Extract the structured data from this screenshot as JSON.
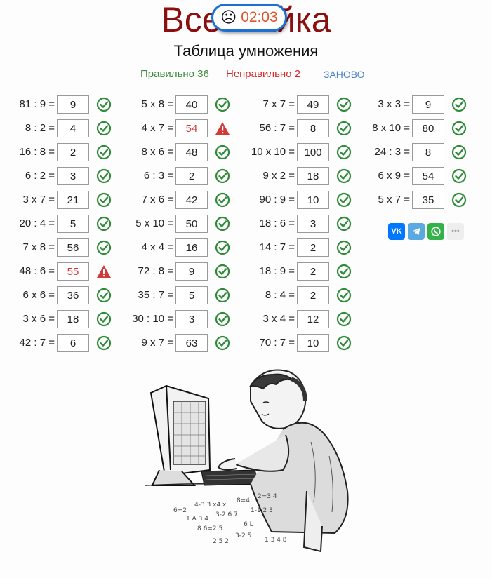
{
  "header": {
    "site_title": "Всезнайка",
    "timer_time": "02:03",
    "subtitle": "Таблица умножения"
  },
  "stats": {
    "correct_label": "Правильно 36",
    "wrong_label": "Неправильно 2",
    "restart_label": "ЗАНОВО"
  },
  "columns": [
    [
      {
        "expr": "81 : 9 =",
        "answer": "9",
        "ok": true
      },
      {
        "expr": "8 : 2 =",
        "answer": "4",
        "ok": true
      },
      {
        "expr": "16 : 8 =",
        "answer": "2",
        "ok": true
      },
      {
        "expr": "6 : 2 =",
        "answer": "3",
        "ok": true
      },
      {
        "expr": "3 x 7 =",
        "answer": "21",
        "ok": true
      },
      {
        "expr": "20 : 4 =",
        "answer": "5",
        "ok": true
      },
      {
        "expr": "7 x 8 =",
        "answer": "56",
        "ok": true
      },
      {
        "expr": "48 : 6 =",
        "answer": "55",
        "ok": false
      },
      {
        "expr": "6 x 6 =",
        "answer": "36",
        "ok": true
      },
      {
        "expr": "3 x 6 =",
        "answer": "18",
        "ok": true
      },
      {
        "expr": "42 : 7 =",
        "answer": "6",
        "ok": true
      }
    ],
    [
      {
        "expr": "5 x 8 =",
        "answer": "40",
        "ok": true
      },
      {
        "expr": "4 x 7 =",
        "answer": "54",
        "ok": false
      },
      {
        "expr": "8 x 6 =",
        "answer": "48",
        "ok": true
      },
      {
        "expr": "6 : 3 =",
        "answer": "2",
        "ok": true
      },
      {
        "expr": "7 x 6 =",
        "answer": "42",
        "ok": true
      },
      {
        "expr": "5 x 10 =",
        "answer": "50",
        "ok": true
      },
      {
        "expr": "4 x 4 =",
        "answer": "16",
        "ok": true
      },
      {
        "expr": "72 : 8 =",
        "answer": "9",
        "ok": true
      },
      {
        "expr": "35 : 7 =",
        "answer": "5",
        "ok": true
      },
      {
        "expr": "30 : 10 =",
        "answer": "3",
        "ok": true
      },
      {
        "expr": "9 x 7 =",
        "answer": "63",
        "ok": true
      }
    ],
    [
      {
        "expr": "7 x 7 =",
        "answer": "49",
        "ok": true
      },
      {
        "expr": "56 : 7 =",
        "answer": "8",
        "ok": true
      },
      {
        "expr": "10 x 10 =",
        "answer": "100",
        "ok": true
      },
      {
        "expr": "9 x 2 =",
        "answer": "18",
        "ok": true
      },
      {
        "expr": "90 : 9 =",
        "answer": "10",
        "ok": true
      },
      {
        "expr": "18 : 6 =",
        "answer": "3",
        "ok": true
      },
      {
        "expr": "14 : 7 =",
        "answer": "2",
        "ok": true
      },
      {
        "expr": "18 : 9 =",
        "answer": "2",
        "ok": true
      },
      {
        "expr": "8 : 4 =",
        "answer": "2",
        "ok": true
      },
      {
        "expr": "3 x 4 =",
        "answer": "12",
        "ok": true
      },
      {
        "expr": "70 : 7 =",
        "answer": "10",
        "ok": true
      }
    ],
    [
      {
        "expr": "3 x 3 =",
        "answer": "9",
        "ok": true
      },
      {
        "expr": "8 x 10 =",
        "answer": "80",
        "ok": true
      },
      {
        "expr": "24 : 3 =",
        "answer": "8",
        "ok": true
      },
      {
        "expr": "6 x 9 =",
        "answer": "54",
        "ok": true
      },
      {
        "expr": "5 x 7 =",
        "answer": "35",
        "ok": true
      }
    ]
  ],
  "share": {
    "vk_label": "VK",
    "telegram_icon": "telegram-icon",
    "whatsapp_icon": "whatsapp-icon",
    "more_label": "•••"
  },
  "colors": {
    "title": "#8b0f0f",
    "correct": "#3a8a3a",
    "wrong": "#d22b2b",
    "check": "#2f8a3a",
    "warn": "#d23a3a",
    "timer_border": "#1d6fd1",
    "timer_text": "#e0522a"
  }
}
